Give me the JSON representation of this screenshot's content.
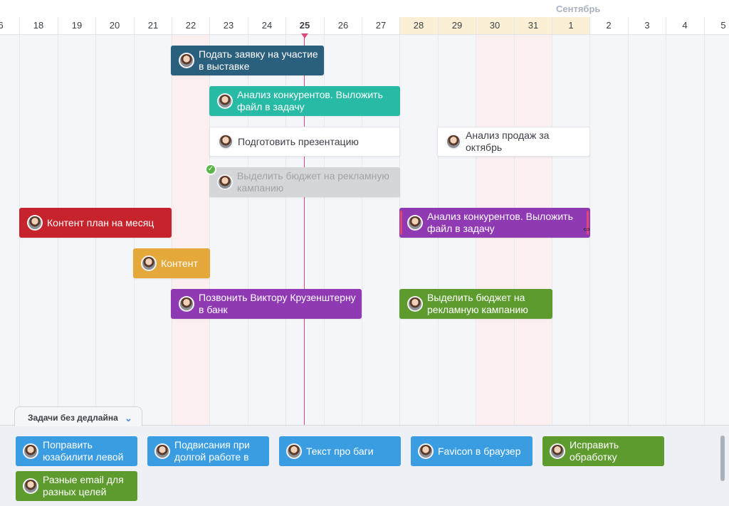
{
  "colors": {
    "navy": "#2b5f7e",
    "teal": "#27bba6",
    "red": "#c7232d",
    "orange": "#e4a93a",
    "purple": "#8f3ab3",
    "green": "#5e9b2f",
    "blue": "#3a9de2",
    "today": "#e0457b"
  },
  "header": {
    "month_label": "Сентябрь",
    "days": [
      "6",
      "18",
      "19",
      "20",
      "21",
      "22",
      "23",
      "24",
      "25",
      "26",
      "27",
      "28",
      "29",
      "30",
      "31",
      "1",
      "2",
      "3",
      "4",
      "5"
    ],
    "today": "25"
  },
  "tasks": [
    {
      "label": "Подать заявку на участие в выставке",
      "color": "navy",
      "avatar": "person-avatar"
    },
    {
      "label": "Анализ конкурентов. Выложить файл в задачу",
      "color": "teal",
      "avatar": "person-avatar"
    },
    {
      "label": "Подготовить презентацию",
      "color": "white",
      "avatar": "person-avatar"
    },
    {
      "label": "Анализ продаж за октябрь",
      "color": "white",
      "avatar": "person-avatar"
    },
    {
      "label": "Выделить бюджет на рекламную кампанию",
      "color": "done",
      "avatar": "person-avatar",
      "completed": true
    },
    {
      "label": "Контент план на месяц",
      "color": "red",
      "avatar": "person-avatar"
    },
    {
      "label": "Анализ конкурентов. Выложить файл в задачу",
      "color": "purple",
      "avatar": "person-avatar",
      "selected": true
    },
    {
      "label": "Контент",
      "color": "orange",
      "avatar": "person-avatar"
    },
    {
      "label": "Позвонить Виктору Крузенштерну в банк",
      "color": "purple",
      "avatar": "person-avatar"
    },
    {
      "label": "Выделить бюджет на рекламную кампанию",
      "color": "green",
      "avatar": "person-avatar"
    }
  ],
  "no_deadline": {
    "tab_label": "Задачи без дедлайна",
    "tab_icon": "chevron-down-icon",
    "cards": [
      {
        "label": "Поправить юзабилити левой",
        "color": "blue"
      },
      {
        "label": "Подвисания при долгой работе в",
        "color": "blue"
      },
      {
        "label": "Текст про баги",
        "color": "blue"
      },
      {
        "label": "Favicon в браузер",
        "color": "blue"
      },
      {
        "label": "Исправить обработку",
        "color": "green"
      },
      {
        "label": "Разные email для разных целей",
        "color": "green"
      }
    ]
  }
}
